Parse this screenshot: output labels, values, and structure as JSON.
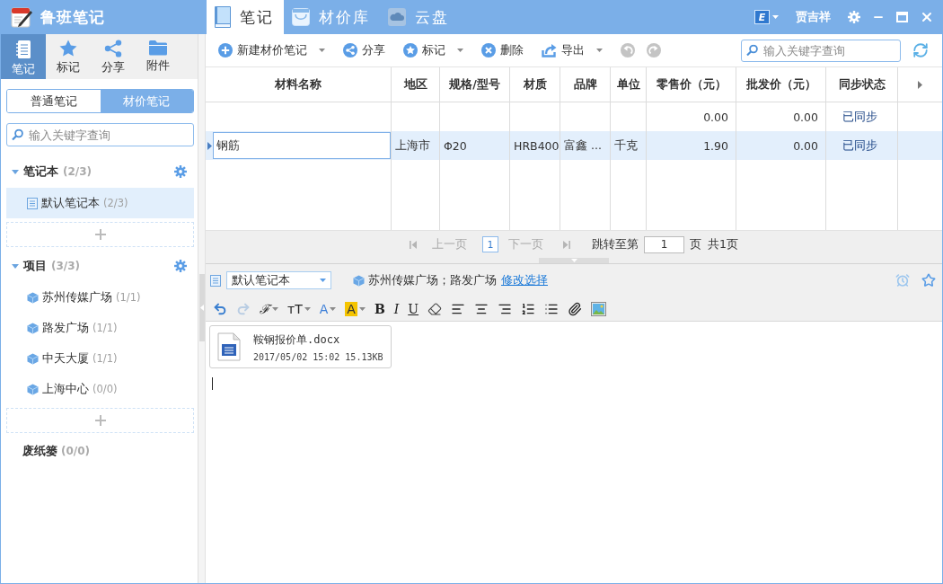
{
  "app": {
    "title": "鲁班笔记"
  },
  "main_tabs": [
    {
      "label": "笔记",
      "selected": true,
      "kind": "notes"
    },
    {
      "label": "材价库",
      "selected": false,
      "kind": "prices"
    },
    {
      "label": "云盘",
      "selected": false,
      "kind": "cloud"
    }
  ],
  "user": {
    "badge": "E",
    "name": "贾吉祥"
  },
  "nav": [
    {
      "label": "笔记",
      "selected": true,
      "kind": "notebook"
    },
    {
      "label": "标记",
      "selected": false,
      "kind": "star"
    },
    {
      "label": "分享",
      "selected": false,
      "kind": "share"
    },
    {
      "label": "附件",
      "selected": false,
      "kind": "folder"
    }
  ],
  "note_types": [
    {
      "label": "普通笔记",
      "selected": false
    },
    {
      "label": "材价笔记",
      "selected": true
    }
  ],
  "sidebar_search": {
    "placeholder": "输入关键字查询"
  },
  "groups": [
    {
      "title": "笔记本",
      "count": "(2/3)",
      "expanded": true,
      "items": [
        {
          "label": "默认笔记本",
          "count": "(2/3)",
          "selected": true,
          "kind": "notebook"
        }
      ]
    },
    {
      "title": "项目",
      "count": "(3/3)",
      "expanded": true,
      "items": [
        {
          "label": "苏州传媒广场",
          "count": "(1/1)",
          "selected": false,
          "kind": "project"
        },
        {
          "label": "路发广场",
          "count": "(1/1)",
          "selected": false,
          "kind": "project"
        },
        {
          "label": "中天大厦",
          "count": "(1/1)",
          "selected": false,
          "kind": "project"
        },
        {
          "label": "上海中心",
          "count": "(0/0)",
          "selected": false,
          "kind": "project"
        }
      ]
    }
  ],
  "trash": {
    "title": "废纸篓",
    "count": "(0/0)"
  },
  "toolbar": {
    "actions": [
      {
        "label": "新建材价笔记",
        "kind": "add",
        "dropdown": true
      },
      {
        "label": "分享",
        "kind": "share",
        "dropdown": false
      },
      {
        "label": "标记",
        "kind": "star",
        "dropdown": true
      },
      {
        "label": "删除",
        "kind": "delete",
        "dropdown": false
      },
      {
        "label": "导出",
        "kind": "export",
        "dropdown": true
      }
    ],
    "history": [
      {
        "kind": "undo",
        "disabled": true
      },
      {
        "kind": "redo",
        "disabled": true
      }
    ],
    "search": {
      "placeholder": "输入关键字查询"
    }
  },
  "table": {
    "columns": [
      "材料名称",
      "地区",
      "规格/型号",
      "材质",
      "品牌",
      "单位",
      "零售价（元）",
      "批发价（元）",
      "同步状态"
    ],
    "rows": [
      {
        "selected": false,
        "editing": false,
        "cells": [
          null,
          null,
          null,
          null,
          null,
          null,
          "0.00",
          "0.00",
          "已同步"
        ]
      },
      {
        "selected": true,
        "editing": true,
        "cells": [
          "钢筋",
          "上海市",
          "Φ20",
          "HRB400",
          "富鑫 ...",
          "千克",
          "1.90",
          "0.00",
          "已同步"
        ]
      }
    ]
  },
  "pagination": {
    "prev": {
      "label": "上一页",
      "disabled": true
    },
    "page": "1",
    "next": {
      "label": "下一页",
      "disabled": true
    },
    "jump_label": "跳转至第",
    "jump_value": "1",
    "page_unit": "页",
    "total": "共1页"
  },
  "editor": {
    "notebook": "默认笔记本",
    "projects": "苏州传媒广场；路发广场",
    "change_link": "修改选择",
    "format_tools": [
      {
        "kind": "undo",
        "disabled": false
      },
      {
        "kind": "redo",
        "disabled": true
      },
      {
        "kind": "font_family",
        "label": "ℱ",
        "disabled": false,
        "dropdown": true
      },
      {
        "kind": "font_size",
        "label": "ᴛT",
        "disabled": false,
        "dropdown": true
      },
      {
        "kind": "font_color",
        "label": "A",
        "disabled": false,
        "dropdown": true
      },
      {
        "kind": "highlight",
        "label": "A",
        "disabled": false,
        "dropdown": true
      },
      {
        "kind": "bold",
        "label": "B",
        "disabled": false,
        "dropdown": false
      },
      {
        "kind": "italic",
        "label": "I",
        "disabled": false,
        "dropdown": false
      },
      {
        "kind": "underline",
        "label": "U",
        "disabled": false,
        "dropdown": false
      },
      {
        "kind": "eraser",
        "disabled": false
      },
      {
        "kind": "align_left",
        "disabled": false
      },
      {
        "kind": "align_center",
        "disabled": false
      },
      {
        "kind": "align_right",
        "disabled": false
      },
      {
        "kind": "ordered_list",
        "disabled": false
      },
      {
        "kind": "bullet_list",
        "disabled": false
      },
      {
        "kind": "attach",
        "disabled": false
      },
      {
        "kind": "image",
        "disabled": false
      }
    ],
    "attachments": [
      {
        "name": "鞍钢报价单.docx",
        "meta": "2017/05/02 15:02 15.13KB"
      }
    ]
  }
}
